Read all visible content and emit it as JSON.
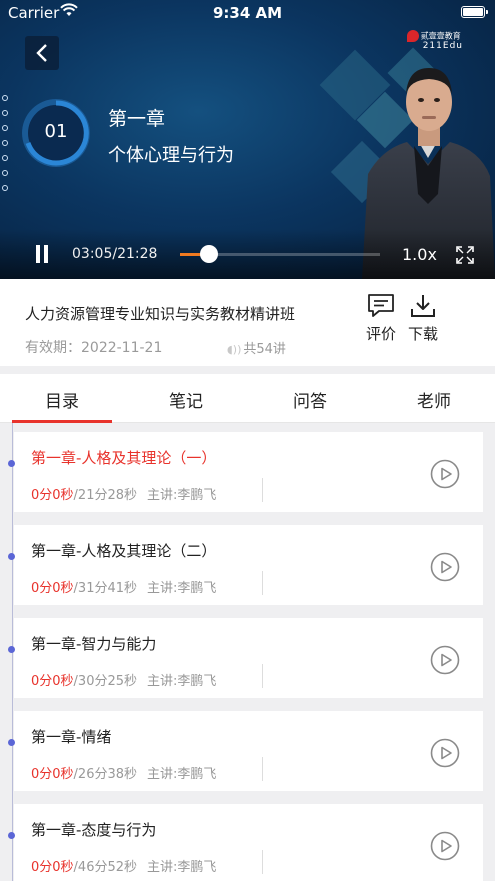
{
  "status_bar": {
    "carrier": "Carrier",
    "time": "9:34 AM"
  },
  "video": {
    "brand_line1": "贰壹壹教育",
    "brand_line2": "211Edu",
    "chapter_number": "01",
    "chapter_title": "第一章",
    "chapter_subtitle": "个体心理与行为",
    "timecode": "03:05/21:28",
    "progress_fraction": 0.144,
    "speed": "1.0x"
  },
  "course": {
    "title": "人力资源管理专业知识与实务教材精讲班",
    "validity": "有效期：2022-11-21",
    "lesson_count": "共54讲",
    "review_label": "评价",
    "download_label": "下载"
  },
  "tabs": [
    {
      "label": "目录"
    },
    {
      "label": "笔记"
    },
    {
      "label": "问答"
    },
    {
      "label": "老师"
    }
  ],
  "lessons": [
    {
      "title": "第一章-人格及其理论（一）",
      "watched": "0分0秒",
      "duration": "/21分28秒",
      "teacher": "主讲:李鹏飞"
    },
    {
      "title": "第一章-人格及其理论（二）",
      "watched": "0分0秒",
      "duration": "/31分41秒",
      "teacher": "主讲:李鹏飞"
    },
    {
      "title": "第一章-智力与能力",
      "watched": "0分0秒",
      "duration": "/30分25秒",
      "teacher": "主讲:李鹏飞"
    },
    {
      "title": "第一章-情绪",
      "watched": "0分0秒",
      "duration": "/26分38秒",
      "teacher": "主讲:李鹏飞"
    },
    {
      "title": "第一章-态度与行为",
      "watched": "0分0秒",
      "duration": "/46分52秒",
      "teacher": "主讲:李鹏飞"
    }
  ],
  "colors": {
    "accent_red": "#e8332c",
    "progress_orange": "#f07a20",
    "timeline_dot": "#5b66d6"
  },
  "icons": [
    "back-icon",
    "wifi-icon",
    "battery-icon",
    "pause-icon",
    "fullscreen-icon",
    "comment-icon",
    "download-icon",
    "play-circle-icon"
  ]
}
